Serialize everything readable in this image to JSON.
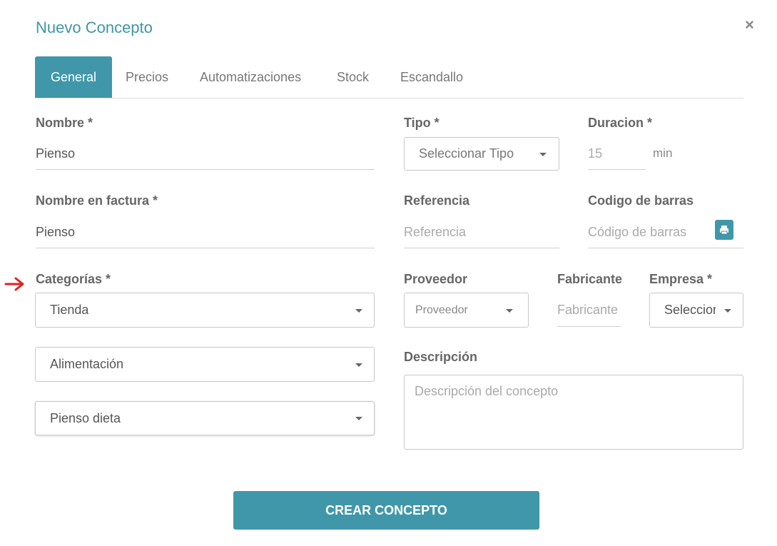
{
  "modal": {
    "title": "Nuevo Concepto",
    "close_label": "×"
  },
  "tabs": [
    {
      "label": "General"
    },
    {
      "label": "Precios"
    },
    {
      "label": "Automatizaciones"
    },
    {
      "label": "Stock"
    },
    {
      "label": "Escandallo"
    }
  ],
  "form": {
    "nombre": {
      "label": "Nombre *",
      "value": "Pienso"
    },
    "nombre_factura": {
      "label": "Nombre en factura *",
      "value": "Pienso"
    },
    "categorias": {
      "label": "Categorías *",
      "selects": [
        "Tienda",
        "Alimentación",
        "Pienso dieta"
      ]
    },
    "tipo": {
      "label": "Tipo *",
      "value": "Seleccionar Tipo"
    },
    "duracion": {
      "label": "Duracion *",
      "placeholder": "15",
      "unit": "min"
    },
    "referencia": {
      "label": "Referencia",
      "placeholder": "Referencia"
    },
    "codigo_barras": {
      "label": "Codigo de barras",
      "placeholder": "Código de barras"
    },
    "proveedor": {
      "label": "Proveedor",
      "value": "Proveedor"
    },
    "fabricante": {
      "label": "Fabricante",
      "placeholder": "Fabricante"
    },
    "empresa": {
      "label": "Empresa *",
      "value": "Seleccior"
    },
    "descripcion": {
      "label": "Descripción",
      "placeholder": "Descripción del concepto"
    }
  },
  "actions": {
    "submit_label": "CREAR CONCEPTO"
  },
  "colors": {
    "accent": "#4097a9",
    "title": "#3e96a8",
    "annotation_arrow": "#e02020"
  },
  "icons": {
    "close": "close-icon",
    "print": "print-icon",
    "annotation": "arrow-right-icon"
  }
}
